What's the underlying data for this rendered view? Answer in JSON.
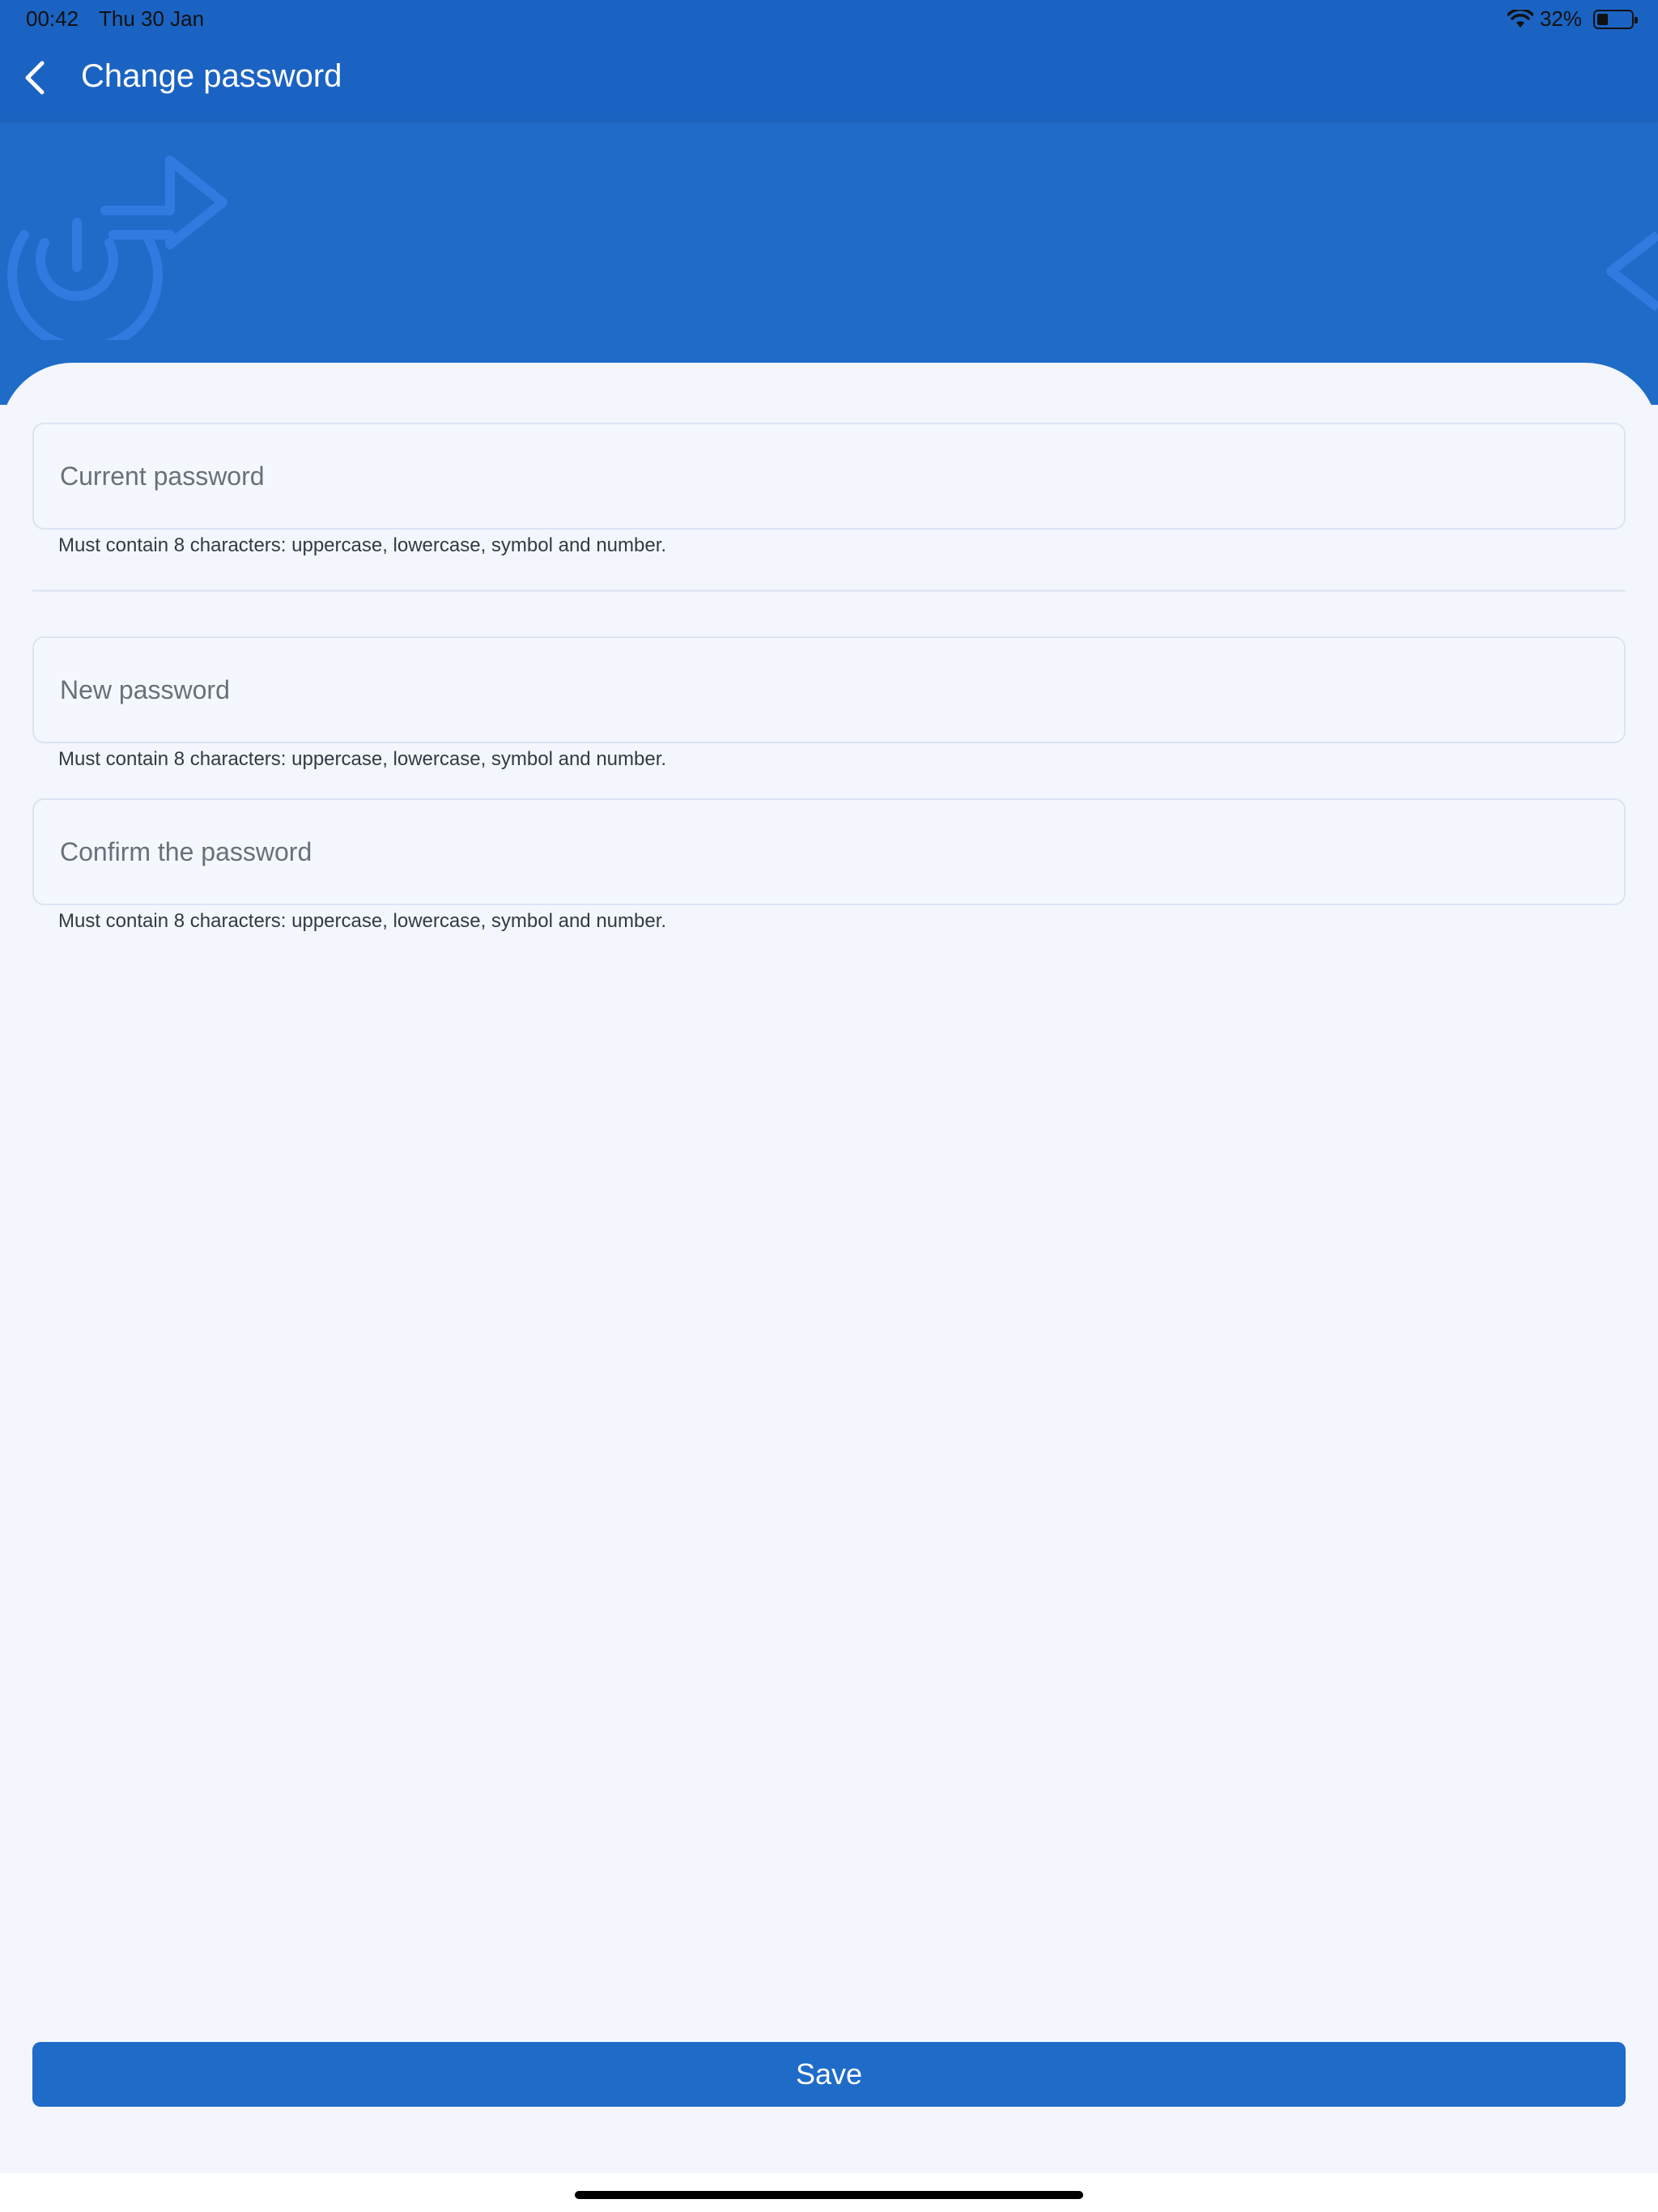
{
  "status_bar": {
    "time": "00:42",
    "date": "Thu 30 Jan",
    "battery": "32%",
    "battery_level": 0.32,
    "icons": [
      "wifi-icon",
      "battery-icon"
    ]
  },
  "header": {
    "title": "Change password",
    "back_icon": "chevron-left-icon"
  },
  "form": {
    "current_password": {
      "placeholder": "Current password",
      "value": "",
      "hint": "Must contain 8 characters: uppercase, lowercase, symbol and number."
    },
    "new_password": {
      "placeholder": "New password",
      "value": "",
      "hint": "Must contain 8 characters: uppercase, lowercase, symbol and number."
    },
    "confirm_password": {
      "placeholder": "Confirm the password",
      "value": "",
      "hint": "Must contain 8 characters: uppercase, lowercase, symbol and number."
    }
  },
  "actions": {
    "save_label": "Save"
  },
  "colors": {
    "primary": "#1f6bc8",
    "navbar": "#1b63c2",
    "background": "#f3f6fd",
    "field_border": "#dbe4f3"
  }
}
